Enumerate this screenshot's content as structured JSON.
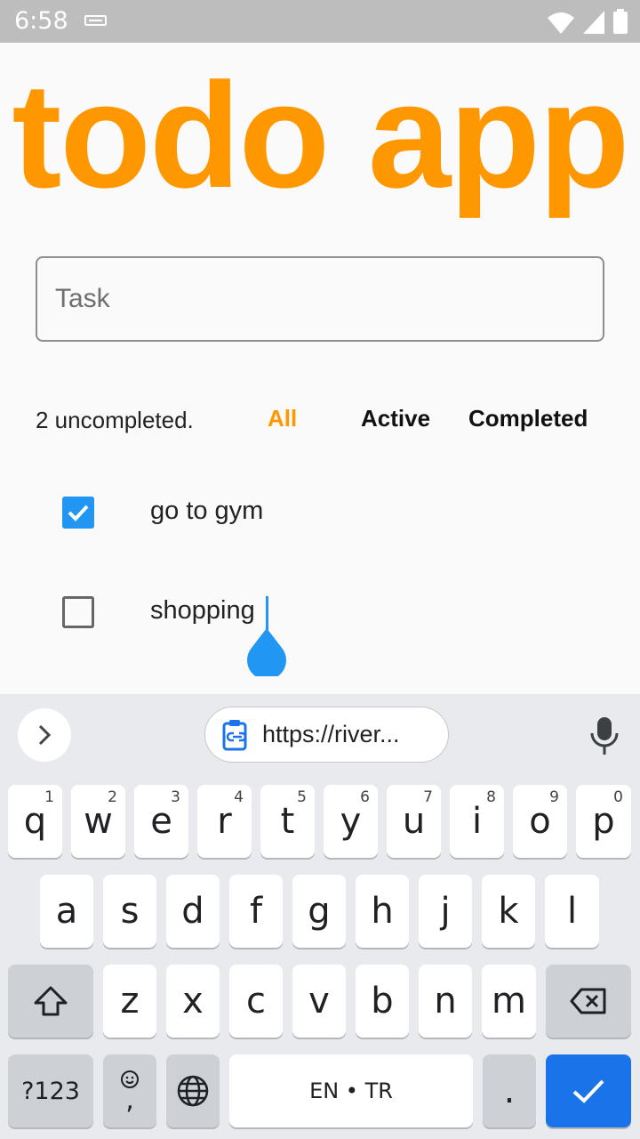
{
  "status_bar": {
    "time": "6:58"
  },
  "app": {
    "title": "todo app",
    "task_input": {
      "placeholder": "Task",
      "value": ""
    },
    "uncompleted_text": "2 uncompleted.",
    "filters": {
      "all": "All",
      "active": "Active",
      "completed": "Completed"
    },
    "accent_color": "#ff9800",
    "todos": [
      {
        "label": "go to gym",
        "done": true
      },
      {
        "label": "shopping",
        "done": false
      }
    ]
  },
  "keyboard": {
    "clipboard_suggestion": "https://river...",
    "row1": [
      {
        "key": "q",
        "hint": "1"
      },
      {
        "key": "w",
        "hint": "2"
      },
      {
        "key": "e",
        "hint": "3"
      },
      {
        "key": "r",
        "hint": "4"
      },
      {
        "key": "t",
        "hint": "5"
      },
      {
        "key": "y",
        "hint": "6"
      },
      {
        "key": "u",
        "hint": "7"
      },
      {
        "key": "i",
        "hint": "8"
      },
      {
        "key": "o",
        "hint": "9"
      },
      {
        "key": "p",
        "hint": "0"
      }
    ],
    "row2": [
      "a",
      "s",
      "d",
      "f",
      "g",
      "h",
      "j",
      "k",
      "l"
    ],
    "row3": [
      "z",
      "x",
      "c",
      "v",
      "b",
      "n",
      "m"
    ],
    "symbols_label": "?123",
    "emoji_comma": ",",
    "space_label": "EN • TR",
    "period": "."
  }
}
